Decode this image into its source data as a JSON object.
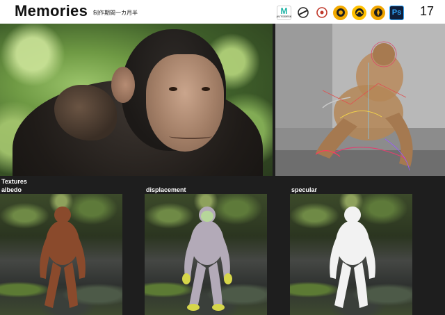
{
  "header": {
    "title": "Memories",
    "subtitle": "制作期間一カ月半",
    "page_number": "17",
    "app_icons": [
      {
        "name": "maya-icon",
        "glyph": "M",
        "caption": "AUTODESK"
      },
      {
        "name": "zbrush-icon",
        "glyph": ""
      },
      {
        "name": "substance-icon",
        "glyph": ""
      },
      {
        "name": "arnold-icon",
        "glyph": ""
      },
      {
        "name": "mari-icon",
        "glyph": ""
      },
      {
        "name": "nuke-icon",
        "glyph": ""
      },
      {
        "name": "photoshop-icon",
        "glyph": "Ps"
      }
    ]
  },
  "textures": {
    "section_label": "Textures",
    "maps": [
      {
        "label": "albedo",
        "color": "#8a4a2c"
      },
      {
        "label": "displacement",
        "color": "#b3aab8"
      },
      {
        "label": "specular",
        "color": "#f2f2f2"
      }
    ]
  },
  "colors": {
    "header_bg": "#ffffff",
    "page_bg": "#1e1e1e",
    "accent_maya": "#1bb3a4",
    "accent_ps": "#31a8ff"
  }
}
